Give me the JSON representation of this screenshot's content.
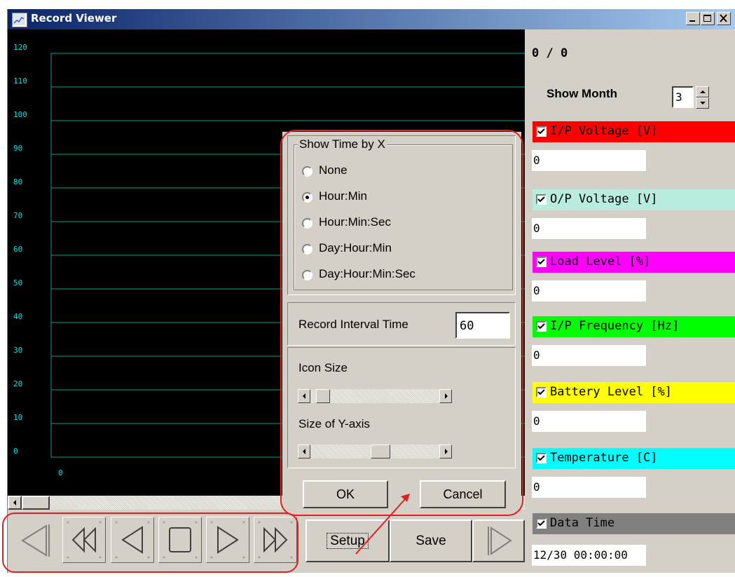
{
  "window": {
    "title": "Record Viewer"
  },
  "chart": {
    "y_ticks": [
      "120",
      "110",
      "100",
      "90",
      "80",
      "70",
      "60",
      "50",
      "40",
      "30",
      "20",
      "10",
      "0"
    ],
    "x_tick": "0",
    "ylim": [
      0,
      120
    ],
    "line_color": "#00a0a0",
    "text_color": "#00e0e0"
  },
  "toolbar": {
    "setup_label": "Setup",
    "save_label": "Save"
  },
  "panel": {
    "counter": "0 / 0",
    "show_month_label": "Show Month",
    "show_month_value": "3",
    "series": [
      {
        "label": "I/P Voltage [V]",
        "color": "#ff0000",
        "checked": true,
        "value": "0"
      },
      {
        "label": "O/P Voltage [V]",
        "color": "#b8ecdc",
        "checked": true,
        "value": "0"
      },
      {
        "label": "Load Level [%]",
        "color": "#ff00ff",
        "checked": true,
        "value": "0"
      },
      {
        "label": "I/P Frequency [Hz]",
        "color": "#00ff00",
        "checked": true,
        "value": "0"
      },
      {
        "label": "Battery Level [%]",
        "color": "#ffff00",
        "checked": true,
        "value": "0"
      },
      {
        "label": "Temperature [C]",
        "color": "#00ffff",
        "checked": true,
        "value": "0"
      },
      {
        "label": "Data Time",
        "color": "#808080",
        "checked": true,
        "value": "12/30 00:00:00"
      }
    ]
  },
  "dialog": {
    "group_title": "Show Time by X",
    "options": [
      "None",
      "Hour:Min",
      "Hour:Min:Sec",
      "Day:Hour:Min",
      "Day:Hour:Min:Sec"
    ],
    "selected_index": 1,
    "interval_label": "Record Interval Time",
    "interval_value": "60",
    "icon_size_label": "Icon Size",
    "icon_size_level": 0.05,
    "y_axis_label": "Size of Y-axis",
    "y_axis_level": 0.55,
    "ok_label": "OK",
    "cancel_label": "Cancel"
  },
  "annotation_color": "#e02020"
}
